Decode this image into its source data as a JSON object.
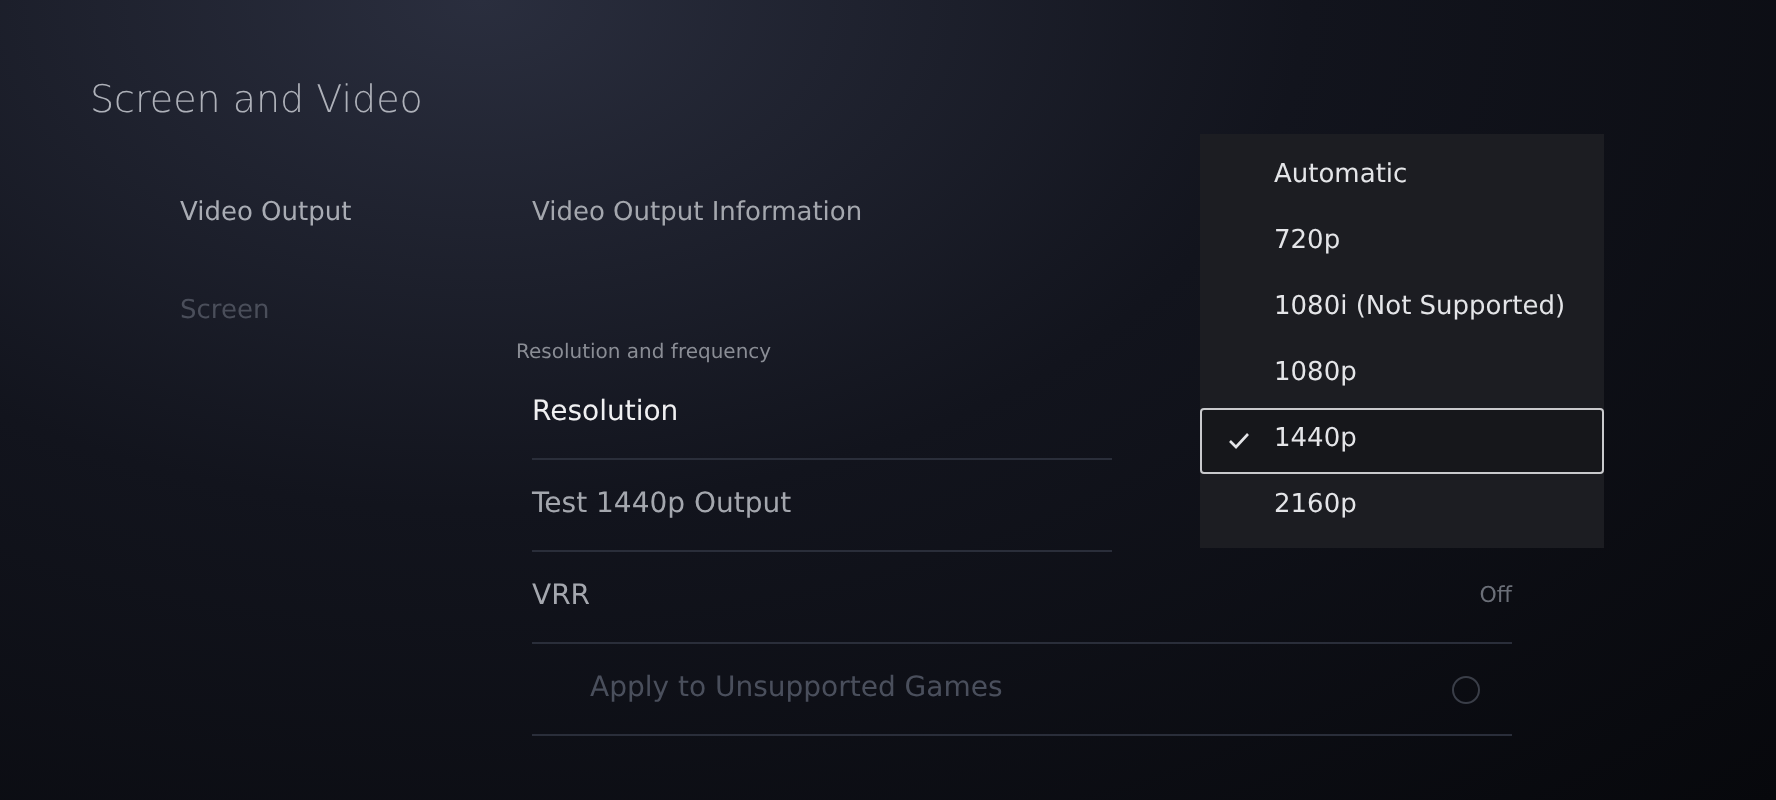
{
  "title": "Screen and Video",
  "sidebar": {
    "items": [
      {
        "label": "Video Output",
        "selected": true
      },
      {
        "label": "Screen",
        "selected": false
      }
    ]
  },
  "main": {
    "info_link": "Video Output Information",
    "section": "Resolution and frequency",
    "rows": [
      {
        "kind": "select",
        "label": "Resolution"
      },
      {
        "kind": "action",
        "label": "Test 1440p Output"
      },
      {
        "kind": "value",
        "label": "VRR",
        "value": "Off"
      },
      {
        "kind": "toggle",
        "label": "Apply to Unsupported Games",
        "on": false,
        "disabled": true
      }
    ]
  },
  "dropdown": {
    "options": [
      {
        "label": "Automatic",
        "selected": false
      },
      {
        "label": "720p",
        "selected": false
      },
      {
        "label": "1080i (Not Supported)",
        "selected": false
      },
      {
        "label": "1080p",
        "selected": false
      },
      {
        "label": "1440p",
        "selected": true
      },
      {
        "label": "2160p",
        "selected": false
      }
    ]
  }
}
